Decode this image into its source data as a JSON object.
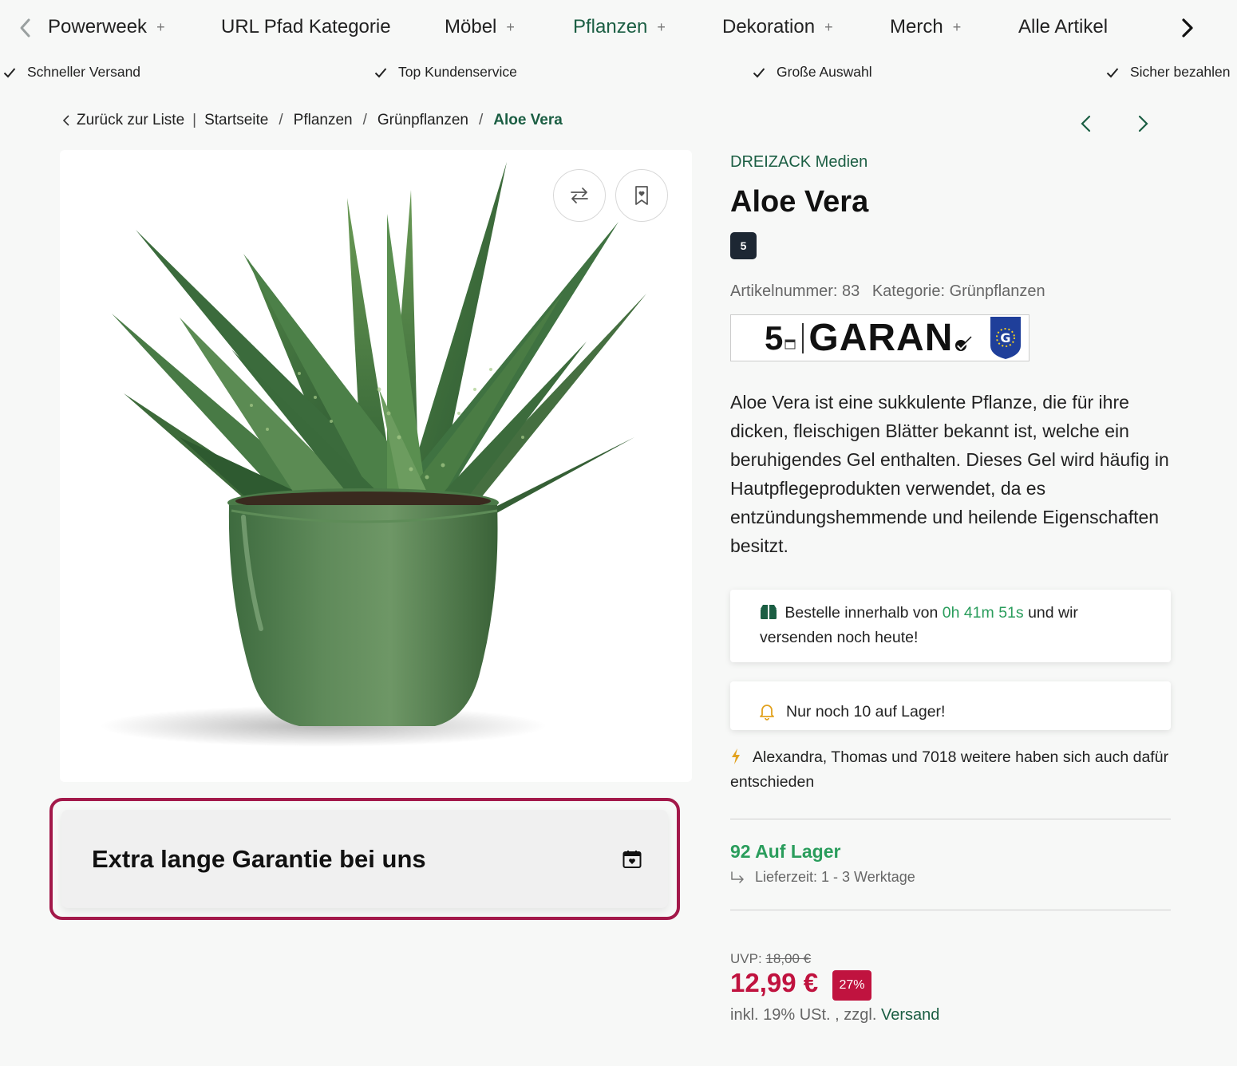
{
  "nav": {
    "items": [
      {
        "label": "Powerweek",
        "has_children": true
      },
      {
        "label": "URL Pfad Kategorie",
        "has_children": false
      },
      {
        "label": "Möbel",
        "has_children": true
      },
      {
        "label": "Pflanzen",
        "has_children": true,
        "active": true
      },
      {
        "label": "Dekoration",
        "has_children": true
      },
      {
        "label": "Merch",
        "has_children": true
      },
      {
        "label": "Alle Artikel",
        "has_children": false
      }
    ],
    "plus_symbol": "+"
  },
  "usps": [
    "Schneller Versand",
    "Top Kundenservice",
    "Große Auswahl",
    "Sicher bezahlen"
  ],
  "breadcrumb": {
    "back": "Zurück zur Liste",
    "divider": "|",
    "separator": "/",
    "items": [
      "Startseite",
      "Pflanzen",
      "Grünpflanzen"
    ],
    "current": "Aloe Vera"
  },
  "product": {
    "manufacturer": "DREIZACK Medien",
    "title": "Aloe Vera",
    "rating_badge": "5",
    "article_number": "Artikelnummer: 83",
    "category": "Kategorie: Grünpflanzen",
    "description": "Aloe Vera ist eine sukkulente Pflanze, die für ihre dicken, fleischigen Blätter bekannt ist, welche ein beruhigendes Gel enthalten. Dieses Gel wird häufig in Hautpflegeprodukten verwendet, da es entzündungshemmende und heilende Eigenschaften besitzt."
  },
  "garantie_logo": {
    "number": "5",
    "word": "GARAN"
  },
  "shipping_notice": {
    "before": "Bestelle innerhalb von",
    "timer": "0h 41m 51s",
    "after": "und wir versenden noch heute!"
  },
  "stock_notice": "Nur noch 10 auf Lager!",
  "social_proof": "Alexandra, Thomas und 7018 weitere haben sich auch dafür entschieden",
  "availability": {
    "status": "92 Auf Lager",
    "delivery": "Lieferzeit: 1 - 3 Werktage"
  },
  "pricing": {
    "uvp_label": "UVP:",
    "uvp_price": "18,00 €",
    "price": "12,99 €",
    "discount": "27%",
    "tax_text": "inkl. 19% USt. , zzgl.",
    "shipping_link": "Versand"
  },
  "guarantee_box": {
    "title": "Extra lange Garantie bei uns"
  },
  "colors": {
    "brand_green": "#1b5e43",
    "stock_green": "#2a9d5c",
    "price_red": "#c0133f",
    "highlight_border": "#a3194a"
  },
  "icons": {
    "compare": "compare-arrows-icon",
    "wishlist": "bookmark-heart-icon",
    "calendar": "calendar-heart-icon",
    "box": "package-icon",
    "bell": "bell-icon",
    "bolt": "lightning-icon",
    "delivery": "return-arrow-icon"
  }
}
